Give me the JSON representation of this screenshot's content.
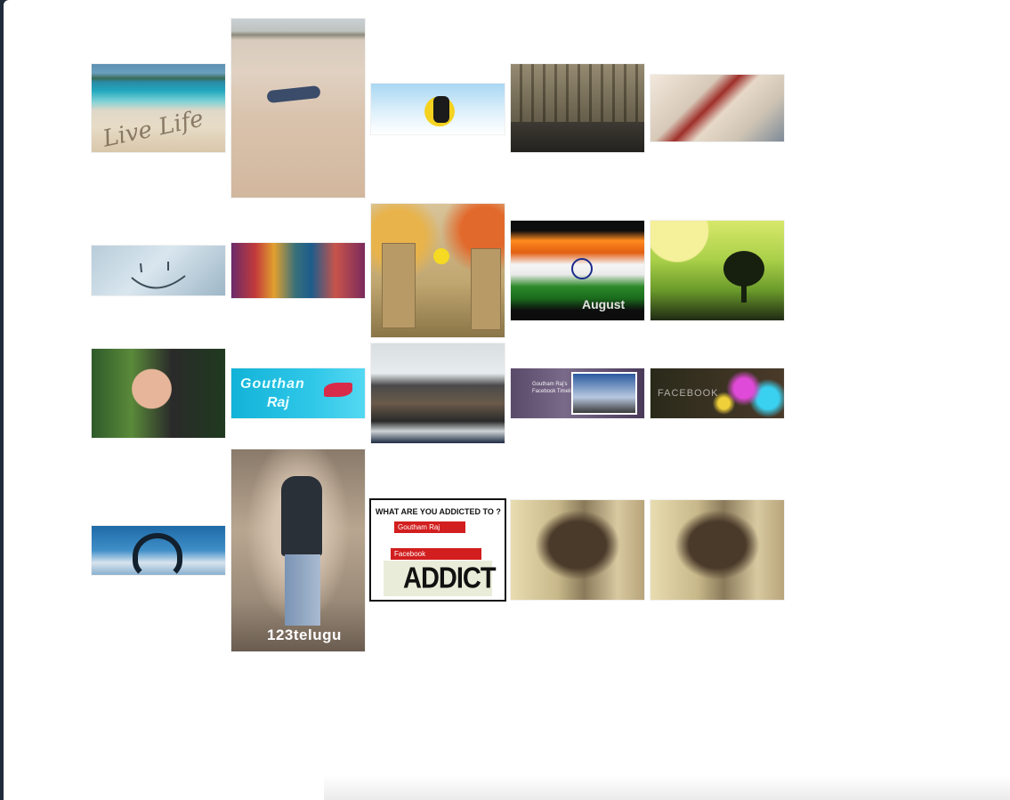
{
  "images": [
    {
      "id": "live-life-beach",
      "caption": "Live Life"
    },
    {
      "id": "man-on-beach"
    },
    {
      "id": "popeye-cartoon"
    },
    {
      "id": "college-building"
    },
    {
      "id": "eiffel-tower-closeup"
    },
    {
      "id": "smiley-on-glass"
    },
    {
      "id": "movie-still-group"
    },
    {
      "id": "danbo-flowers"
    },
    {
      "id": "india-flag-15-august",
      "caption": "August"
    },
    {
      "id": "tree-rainbow-art"
    },
    {
      "id": "woman-portrait"
    },
    {
      "id": "gouthan-raj-fish",
      "caption_line1": "Gouthan",
      "caption_line2": "Raj"
    },
    {
      "id": "class-group-photo"
    },
    {
      "id": "facebook-timeline-cover",
      "caption": "Goutham Raj's Facebook Timeline"
    },
    {
      "id": "facebook-bokeh",
      "caption": "FACEBOOK"
    },
    {
      "id": "heart-hands-sky"
    },
    {
      "id": "actor-walking-123telugu",
      "caption": "123telugu"
    },
    {
      "id": "addicted-to",
      "question": "WHAT ARE YOU ADDICTED TO ?",
      "name": "Goutham Raj",
      "site": "Facebook",
      "word": "ADDICT"
    },
    {
      "id": "couple-kiss-1"
    },
    {
      "id": "couple-kiss-2"
    }
  ]
}
